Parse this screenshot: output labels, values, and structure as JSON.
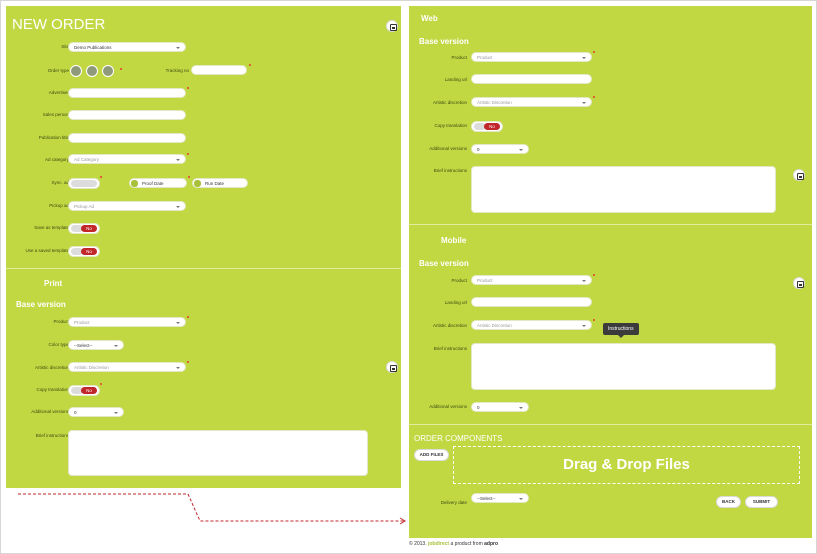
{
  "left": {
    "title": "NEW ORDER",
    "site_label": "Site",
    "site_value": "Demo Publications",
    "ordertype_label": "Order type",
    "tracking_label": "Tracking no",
    "advertiser_label": "Advertiser",
    "salesperson_label": "Sales person",
    "pubtitle_label": "Publication title",
    "adcategory_label": "Ad category",
    "adcategory_placeholder": "Ad Category",
    "sync_label": "Sync. ad",
    "proof_label": "Proof Date",
    "run_label": "Run Date",
    "pickup_label": "Pickup ad",
    "pickup_placeholder": "Pickup Ad",
    "savetemplate_label": "Save as template",
    "usetemplate_label": "Use a saved template",
    "no_label": "No"
  },
  "print": {
    "heading": "Print",
    "base_version": "Base version",
    "product_label": "Product",
    "product_placeholder": "Product",
    "colortype_label": "Color type",
    "colortype_value": "--Select--",
    "artistic_label": "Artistic discretion",
    "artistic_placeholder": "Artistic Discretion",
    "copytrans_label": "Copy translation",
    "addver_label": "Additional versions",
    "addver_value": "0",
    "brief_label": "Brief instructions",
    "no_label": "No"
  },
  "web": {
    "heading": "Web",
    "base_version": "Base version",
    "product_label": "Product",
    "product_placeholder": "Product",
    "landing_label": "Landing url",
    "artistic_label": "Artistic discretion",
    "artistic_placeholder": "Artistic Discretion",
    "copytrans_label": "Copy translation",
    "addver_label": "Additional versions",
    "addver_value": "0",
    "brief_label": "Brief instructions",
    "no_label": "No"
  },
  "mobile": {
    "heading": "Mobile",
    "base_version": "Base version",
    "product_label": "Product",
    "product_placeholder": "Product",
    "landing_label": "Landing url",
    "artistic_label": "Artistic discretion",
    "artistic_placeholder": "Artistic Discretion",
    "brief_label": "Brief instructions",
    "tooltip": "Instructions",
    "addver_label": "Additional versions",
    "addver_value": "0"
  },
  "components": {
    "heading": "ORDER COMPONENTS",
    "add_files": "ADD FILES",
    "dropzone": "Drag & Drop Files",
    "delivery_label": "Delivery date",
    "delivery_value": "--Select--",
    "back": "BACK",
    "submit": "SUBMIT"
  },
  "footer": {
    "copyright": "© 2013.",
    "brand": "jobdirect",
    "tagline": "a product from",
    "company": "adpro"
  },
  "colors": {
    "panel": "#c1d843",
    "required": "#e23b2e",
    "toggle_no": "#c0262a",
    "connector": "#c0262a"
  }
}
